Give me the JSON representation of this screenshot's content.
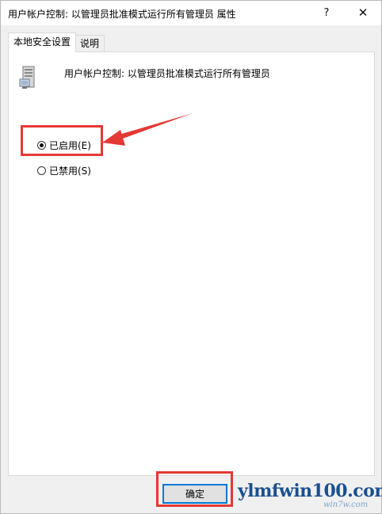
{
  "window": {
    "title": "用户帐户控制: 以管理员批准模式运行所有管理员 属性",
    "help_label": "?",
    "close_label": "✕"
  },
  "tabs": [
    {
      "label": "本地安全设置",
      "active": true
    },
    {
      "label": "说明",
      "active": false
    }
  ],
  "policy": {
    "icon": "server-computer-icon",
    "title": "用户帐户控制: 以管理员批准模式运行所有管理员"
  },
  "options": {
    "enabled_label": "已启用(E)",
    "enabled_selected": true,
    "disabled_label": "已禁用(S)",
    "disabled_selected": false
  },
  "footer": {
    "ok_label": "确定"
  },
  "annotations": {
    "highlight_color": "#e53935"
  },
  "watermark": {
    "text": "ylmfwin100.com",
    "subtext": "win7w.com"
  }
}
